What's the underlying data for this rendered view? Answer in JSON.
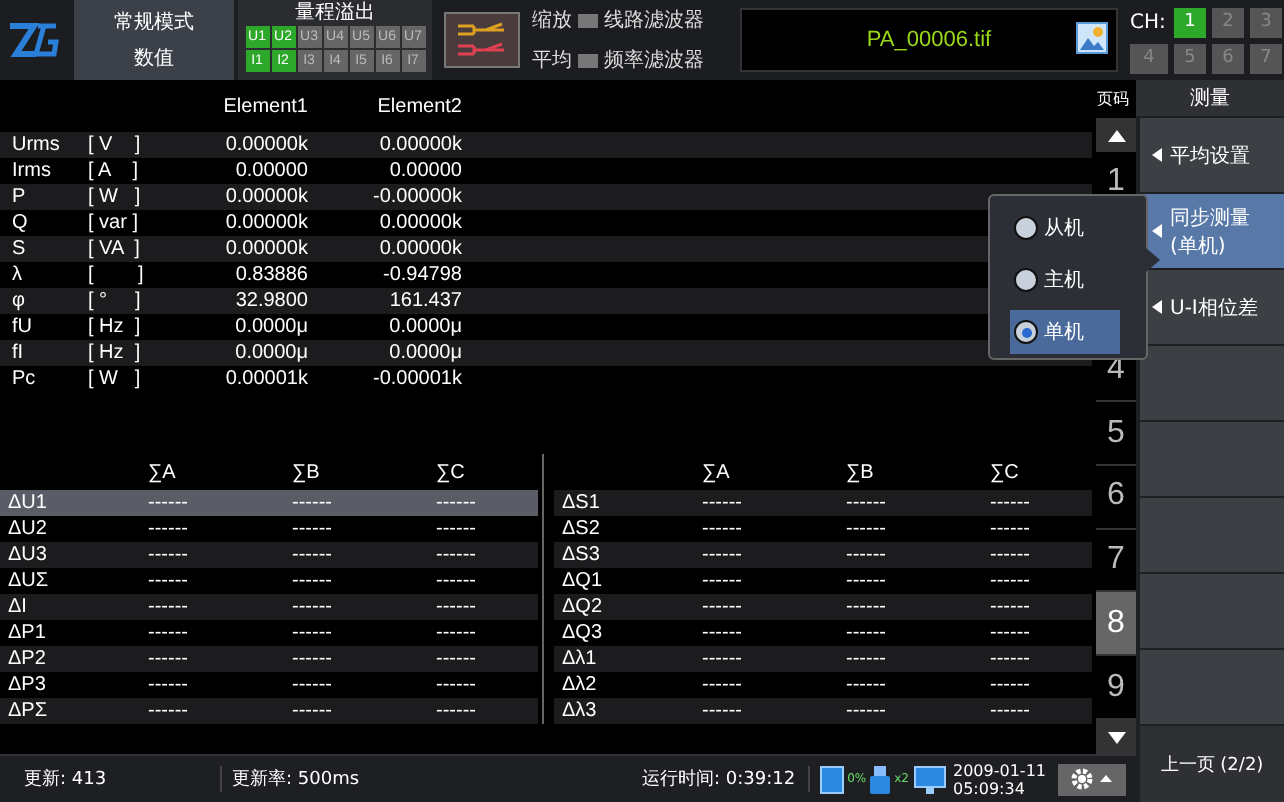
{
  "top_bar": {
    "mode": [
      "常规模式",
      "数值"
    ],
    "overflow": {
      "title": "量程溢出",
      "u": [
        {
          "label": "U1",
          "on": true
        },
        {
          "label": "U2",
          "on": true
        },
        {
          "label": "U3",
          "on": false
        },
        {
          "label": "U4",
          "on": false
        },
        {
          "label": "U5",
          "on": false
        },
        {
          "label": "U6",
          "on": false
        },
        {
          "label": "U7",
          "on": false
        }
      ],
      "i": [
        {
          "label": "I1",
          "on": true
        },
        {
          "label": "I2",
          "on": true
        },
        {
          "label": "I3",
          "on": false
        },
        {
          "label": "I4",
          "on": false
        },
        {
          "label": "I5",
          "on": false
        },
        {
          "label": "I6",
          "on": false
        },
        {
          "label": "I7",
          "on": false
        }
      ]
    },
    "options": [
      {
        "label": "缩放",
        "filter": "线路滤波器",
        "checked": false
      },
      {
        "label": "平均",
        "filter": "频率滤波器",
        "checked": false
      }
    ],
    "file": "PA_00006.tif",
    "channels": {
      "title": "CH:",
      "items": [
        {
          "label": "1",
          "selected": true
        },
        {
          "label": "2",
          "selected": false
        },
        {
          "label": "3",
          "selected": false
        },
        {
          "label": "4",
          "selected": false
        },
        {
          "label": "5",
          "selected": false
        },
        {
          "label": "6",
          "selected": false
        },
        {
          "label": "7",
          "selected": false
        }
      ]
    }
  },
  "measure_table": {
    "columns": [
      "Element1",
      "Element2"
    ],
    "rows": [
      {
        "name": "Urms",
        "unit": "[ V    ]",
        "values": [
          "0.00000k",
          "0.00000k"
        ]
      },
      {
        "name": "Irms",
        "unit": "[ A    ]",
        "values": [
          "0.00000",
          "0.00000"
        ]
      },
      {
        "name": "P",
        "unit": "[ W   ]",
        "values": [
          "0.00000k",
          "-0.00000k"
        ]
      },
      {
        "name": "Q",
        "unit": "[ var ]",
        "values": [
          "0.00000k",
          "0.00000k"
        ]
      },
      {
        "name": "S",
        "unit": "[ VA  ]",
        "values": [
          "0.00000k",
          "0.00000k"
        ]
      },
      {
        "name": "λ",
        "unit": "[        ]",
        "values": [
          "0.83886",
          "-0.94798"
        ]
      },
      {
        "name": "φ",
        "unit": "[ °     ]",
        "values": [
          "32.9800",
          "161.437"
        ]
      },
      {
        "name": "fU",
        "unit": "[ Hz  ]",
        "values": [
          "0.0000μ",
          "0.0000μ"
        ]
      },
      {
        "name": "fI",
        "unit": "[ Hz  ]",
        "values": [
          "0.0000μ",
          "0.0000μ"
        ]
      },
      {
        "name": "Pc",
        "unit": "[ W   ]",
        "values": [
          "0.00001k",
          "-0.00001k"
        ]
      }
    ]
  },
  "sigma_tables": [
    {
      "columns": [
        "∑A",
        "∑B",
        "∑C"
      ],
      "rows": [
        {
          "name": "ΔU1",
          "values": [
            "------",
            "------",
            "------"
          ],
          "selected": true
        },
        {
          "name": "ΔU2",
          "values": [
            "------",
            "------",
            "------"
          ],
          "selected": false
        },
        {
          "name": "ΔU3",
          "values": [
            "------",
            "------",
            "------"
          ],
          "selected": false
        },
        {
          "name": "ΔUΣ",
          "values": [
            "------",
            "------",
            "------"
          ],
          "selected": false
        },
        {
          "name": "ΔI",
          "values": [
            "------",
            "------",
            "------"
          ],
          "selected": false
        },
        {
          "name": "ΔP1",
          "values": [
            "------",
            "------",
            "------"
          ],
          "selected": false
        },
        {
          "name": "ΔP2",
          "values": [
            "------",
            "------",
            "------"
          ],
          "selected": false
        },
        {
          "name": "ΔP3",
          "values": [
            "------",
            "------",
            "------"
          ],
          "selected": false
        },
        {
          "name": "ΔPΣ",
          "values": [
            "------",
            "------",
            "------"
          ],
          "selected": false
        }
      ]
    },
    {
      "columns": [
        "∑A",
        "∑B",
        "∑C"
      ],
      "rows": [
        {
          "name": "ΔS1",
          "values": [
            "------",
            "------",
            "------"
          ],
          "selected": false
        },
        {
          "name": "ΔS2",
          "values": [
            "------",
            "------",
            "------"
          ],
          "selected": false
        },
        {
          "name": "ΔS3",
          "values": [
            "------",
            "------",
            "------"
          ],
          "selected": false
        },
        {
          "name": "ΔQ1",
          "values": [
            "------",
            "------",
            "------"
          ],
          "selected": false
        },
        {
          "name": "ΔQ2",
          "values": [
            "------",
            "------",
            "------"
          ],
          "selected": false
        },
        {
          "name": "ΔQ3",
          "values": [
            "------",
            "------",
            "------"
          ],
          "selected": false
        },
        {
          "name": "Δλ1",
          "values": [
            "------",
            "------",
            "------"
          ],
          "selected": false
        },
        {
          "name": "Δλ2",
          "values": [
            "------",
            "------",
            "------"
          ],
          "selected": false
        },
        {
          "name": "Δλ3",
          "values": [
            "------",
            "------",
            "------"
          ],
          "selected": false
        }
      ]
    }
  ],
  "page_nav": {
    "title": "页码",
    "pages": [
      {
        "label": "1",
        "selected": false
      },
      {
        "label": "4",
        "selected": false
      },
      {
        "label": "5",
        "selected": false
      },
      {
        "label": "6",
        "selected": false
      },
      {
        "label": "7",
        "selected": false
      },
      {
        "label": "8",
        "selected": true
      },
      {
        "label": "9",
        "selected": false
      }
    ]
  },
  "menu": {
    "title": "测量",
    "items": [
      {
        "label": "平均设置",
        "selected": false
      },
      {
        "label": "同步测量\n(单机)",
        "selected": true
      },
      {
        "label": "U-I相位差",
        "selected": false
      }
    ],
    "prev_page": "上一页 (2/2)"
  },
  "popup": {
    "options": [
      {
        "label": "从机",
        "selected": false
      },
      {
        "label": "主机",
        "selected": false
      },
      {
        "label": "单机",
        "selected": true
      }
    ]
  },
  "status_bar": {
    "update": "更新: 413",
    "rate": "更新率: 500ms",
    "runtime": "运行时间: 0:39:12",
    "disk": "0%",
    "usb": "x2",
    "date": "2009-01-11",
    "time": "05:09:34"
  }
}
